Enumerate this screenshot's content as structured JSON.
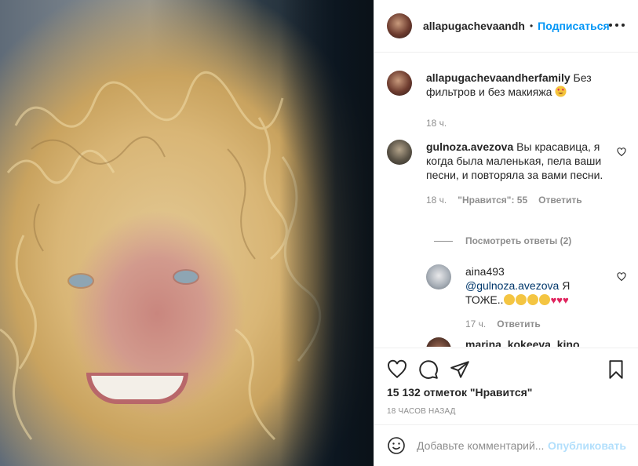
{
  "header": {
    "username": "allapugachevaandh",
    "separator": "•",
    "follow_label": "Подписаться"
  },
  "caption": {
    "username": "allapugachevaandherfamily",
    "text": "Без фильтров и без макияжа",
    "emoji": "smiling-face-with-heart-eyes",
    "time": "18 ч."
  },
  "comments": [
    {
      "username": "gulnoza.avezova",
      "text": "Вы красавица, я когда была маленькая, пела ваши песни, и повторяла за вами песни.",
      "time": "18 ч.",
      "likes_label": "\"Нравится\": 55",
      "reply_label": "Ответить",
      "view_replies_label": "Посмотреть ответы (2)"
    }
  ],
  "reply": {
    "username": "aina493",
    "mention": "@gulnoza.avezova",
    "text": "Я ТОЖЕ..",
    "emojis": [
      "clapping-hands",
      "clapping-hands",
      "clapping-hands",
      "clapping-hands",
      "red-heart",
      "red-heart",
      "red-heart"
    ],
    "time": "17 ч.",
    "reply_label": "Ответить"
  },
  "partial_comment": {
    "username": "marina_kokeeva_kino"
  },
  "actions": {
    "like_icon": "heart-outline-icon",
    "comment_icon": "comment-bubble-icon",
    "share_icon": "paper-plane-icon",
    "save_icon": "bookmark-icon",
    "likes_count": "15 132 отметок \"Нравится\"",
    "time_ago": "18 ЧАСОВ НАЗАД"
  },
  "add_comment": {
    "placeholder": "Добавьте комментарий...",
    "publish_label": "Опубликовать"
  }
}
